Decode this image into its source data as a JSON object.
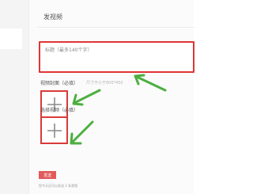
{
  "main": {
    "title": "发视频",
    "title_field": {
      "placeholder": "标题（最多140个字）"
    },
    "cover": {
      "label": "视频封面（必填）",
      "hint": "尺寸不小于800*450"
    },
    "video": {
      "label": "选择视频（必填）"
    },
    "publish_label": "发送",
    "footer_note": "您今天还可以发送 2 条视频"
  },
  "colors": {
    "highlight_border": "#e03535",
    "annotation_arrow": "#4caf3f",
    "publish_button": "#e25a5a"
  },
  "icons": [
    "plus-icon",
    "green-arrow-annotation"
  ]
}
